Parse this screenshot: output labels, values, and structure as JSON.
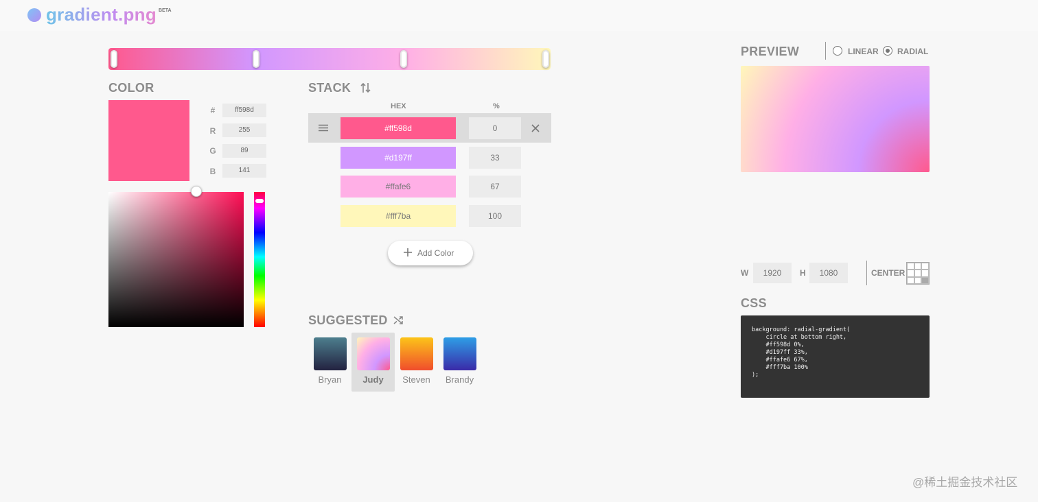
{
  "app": {
    "title": "gradient.png",
    "badge": "BETA"
  },
  "stops": [
    {
      "hex": "#ff598d",
      "percent": "0"
    },
    {
      "hex": "#d197ff",
      "percent": "33"
    },
    {
      "hex": "#ffafe6",
      "percent": "67"
    },
    {
      "hex": "#fff7ba",
      "percent": "100"
    }
  ],
  "color": {
    "heading": "COLOR",
    "hash_label": "#",
    "hex_value": "ff598d",
    "r_label": "R",
    "r_value": "255",
    "g_label": "G",
    "g_value": "89",
    "b_label": "B",
    "b_value": "141"
  },
  "stack": {
    "heading": "STACK",
    "col_hex": "HEX",
    "col_pct": "%",
    "add_label": "Add Color"
  },
  "suggested": {
    "heading": "SUGGESTED",
    "items": [
      {
        "name": "Bryan",
        "colors": [
          "#4d7f8e",
          "#232240"
        ]
      },
      {
        "name": "Judy",
        "colors": [
          "#fff7ba",
          "#ff598d"
        ]
      },
      {
        "name": "Steven",
        "colors": [
          "#fcc419",
          "#f04d2c"
        ]
      },
      {
        "name": "Brandy",
        "colors": [
          "#2e9ee6",
          "#3a2aa8"
        ]
      }
    ]
  },
  "preview": {
    "heading": "PREVIEW",
    "linear_label": "LINEAR",
    "radial_label": "RADIAL",
    "mode": "radial"
  },
  "size": {
    "w_label": "W",
    "w_value": "1920",
    "h_label": "H",
    "h_value": "1080",
    "center_label": "CENTER"
  },
  "css": {
    "heading": "CSS",
    "code": "background: radial-gradient(\n    circle at bottom right,\n    #ff598d 0%,\n    #d197ff 33%,\n    #ffafe6 67%,\n    #fff7ba 100%\n);"
  },
  "watermark": "@稀土掘金技术社区"
}
